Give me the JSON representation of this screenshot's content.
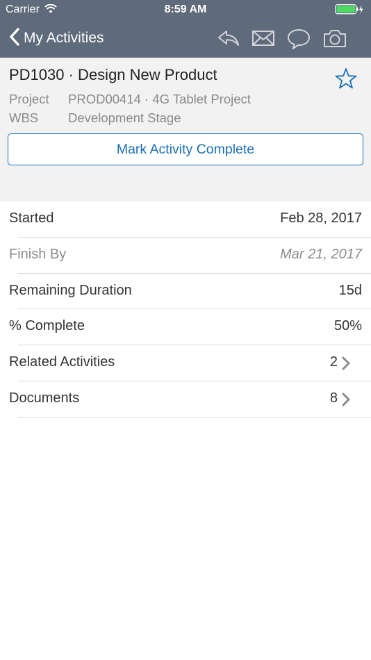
{
  "status_bar": {
    "carrier": "Carrier",
    "time": "8:59 AM"
  },
  "nav": {
    "back_label": "My Activities",
    "icons": [
      "reply-icon",
      "mail-icon",
      "comment-icon",
      "camera-icon"
    ]
  },
  "activity": {
    "title": "PD1030 · Design New Product",
    "project_label": "Project",
    "project_value": "PROD00414 · 4G Tablet Project",
    "wbs_label": "WBS",
    "wbs_value": "Development Stage",
    "complete_button": "Mark Activity Complete"
  },
  "details": [
    {
      "label": "Started",
      "value": "Feb 28, 2017"
    },
    {
      "label": "Finish By",
      "value": "Mar 21, 2017"
    },
    {
      "label": "Remaining Duration",
      "value": "15d"
    },
    {
      "label": "% Complete",
      "value": "50%"
    },
    {
      "label": "Related Activities",
      "value": "2"
    },
    {
      "label": "Documents",
      "value": "8"
    }
  ],
  "colors": {
    "nav_bg": "#5f6b7a",
    "accent": "#1a6fb5",
    "battery": "#4cd964"
  }
}
